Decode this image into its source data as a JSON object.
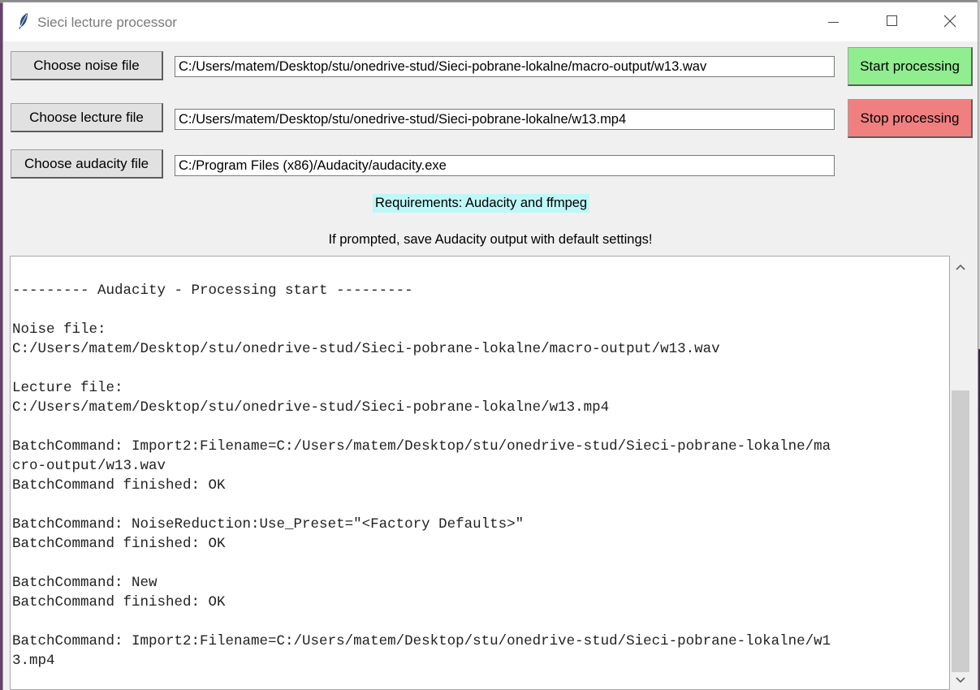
{
  "window": {
    "title": "Sieci lecture processor"
  },
  "buttons": {
    "noise": "Choose noise file",
    "lecture": "Choose lecture file",
    "audacity": "Choose audacity file",
    "start": "Start processing",
    "stop": "Stop processing"
  },
  "fields": {
    "noise_path": "C:/Users/matem/Desktop/stu/onedrive-stud/Sieci-pobrane-lokalne/macro-output/w13.wav",
    "lecture_path": "C:/Users/matem/Desktop/stu/onedrive-stud/Sieci-pobrane-lokalne/w13.mp4",
    "audacity_path": "C:/Program Files (x86)/Audacity/audacity.exe"
  },
  "labels": {
    "requirements": "Requirements: Audacity and ffmpeg",
    "note": "If prompted, save Audacity output with default settings!"
  },
  "log": [
    "",
    "--------- Audacity - Processing start ---------",
    "",
    "Noise file:",
    "C:/Users/matem/Desktop/stu/onedrive-stud/Sieci-pobrane-lokalne/macro-output/w13.wav",
    "",
    "Lecture file:",
    "C:/Users/matem/Desktop/stu/onedrive-stud/Sieci-pobrane-lokalne/w13.mp4",
    "",
    "BatchCommand: Import2:Filename=C:/Users/matem/Desktop/stu/onedrive-stud/Sieci-pobrane-lokalne/ma",
    "cro-output/w13.wav",
    "BatchCommand finished: OK",
    "",
    "BatchCommand: NoiseReduction:Use_Preset=\"<Factory Defaults>\"",
    "BatchCommand finished: OK",
    "",
    "BatchCommand: New",
    "BatchCommand finished: OK",
    "",
    "BatchCommand: Import2:Filename=C:/Users/matem/Desktop/stu/onedrive-stud/Sieci-pobrane-lokalne/w1",
    "3.mp4"
  ],
  "colors": {
    "start_button": "#90ee90",
    "stop_button": "#f08080",
    "requirements_bg": "#bff7f7"
  },
  "icons": {
    "app": "feather-icon",
    "minimize": "minimize-icon",
    "maximize": "maximize-icon",
    "close": "close-icon",
    "scroll_up": "chevron-up-icon",
    "scroll_down": "chevron-down-icon"
  }
}
